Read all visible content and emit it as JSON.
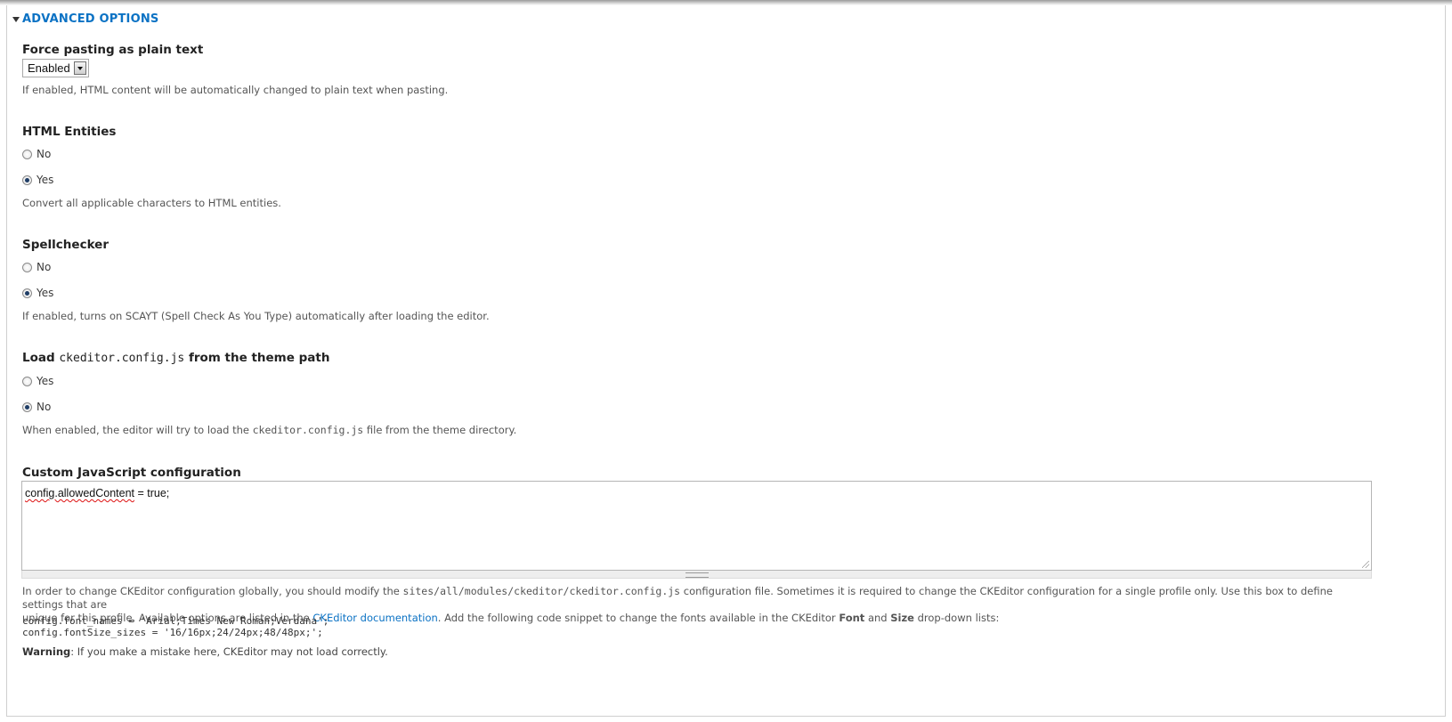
{
  "fieldset": {
    "legend": "ADVANCED OPTIONS"
  },
  "force_paste": {
    "label": "Force pasting as plain text",
    "selected": "Enabled",
    "description": "If enabled, HTML content will be automatically changed to plain text when pasting."
  },
  "html_entities": {
    "label": "HTML Entities",
    "options": [
      "No",
      "Yes"
    ],
    "selected": "Yes",
    "description": "Convert all applicable characters to HTML entities."
  },
  "spellchecker": {
    "label": "Spellchecker",
    "options": [
      "No",
      "Yes"
    ],
    "selected": "Yes",
    "description": "If enabled, turns on SCAYT (Spell Check As You Type) automatically after loading the editor."
  },
  "load_config": {
    "label_prefix": "Load ",
    "label_code": "ckeditor.config.js",
    "label_suffix": " from the theme path",
    "options": [
      "Yes",
      "No"
    ],
    "selected": "No",
    "description_prefix": "When enabled, the editor will try to load the ",
    "description_code": "ckeditor.config.js",
    "description_suffix": " file from the theme directory."
  },
  "custom_js": {
    "label": "Custom JavaScript configuration",
    "value_spell": "config.allowedContent",
    "value_rest": " = true;",
    "help_1": "In order to change CKEditor configuration globally, you should modify the ",
    "help_code": "sites/all/modules/ckeditor/ckeditor.config.js",
    "help_2": " configuration file. Sometimes it is required to change the CKEditor configuration for a single profile only. Use this box to define settings that are",
    "help_3": "unique for this profile. Available options are listed in the ",
    "help_link": "CKEditor documentation",
    "help_4": ". Add the following code snippet to change the fonts available in the CKEditor ",
    "help_font": "Font",
    "help_and": " and ",
    "help_size": "Size",
    "help_5": " drop-down lists:",
    "snippet_1": "config.font_names = 'Arial;Times New Roman;Verdana';",
    "snippet_2": "config.fontSize_sizes = '16/16px;24/24px;48/48px;';",
    "warning_label": "Warning",
    "warning_text": ": If you make a mistake here, CKEditor may not load correctly."
  }
}
